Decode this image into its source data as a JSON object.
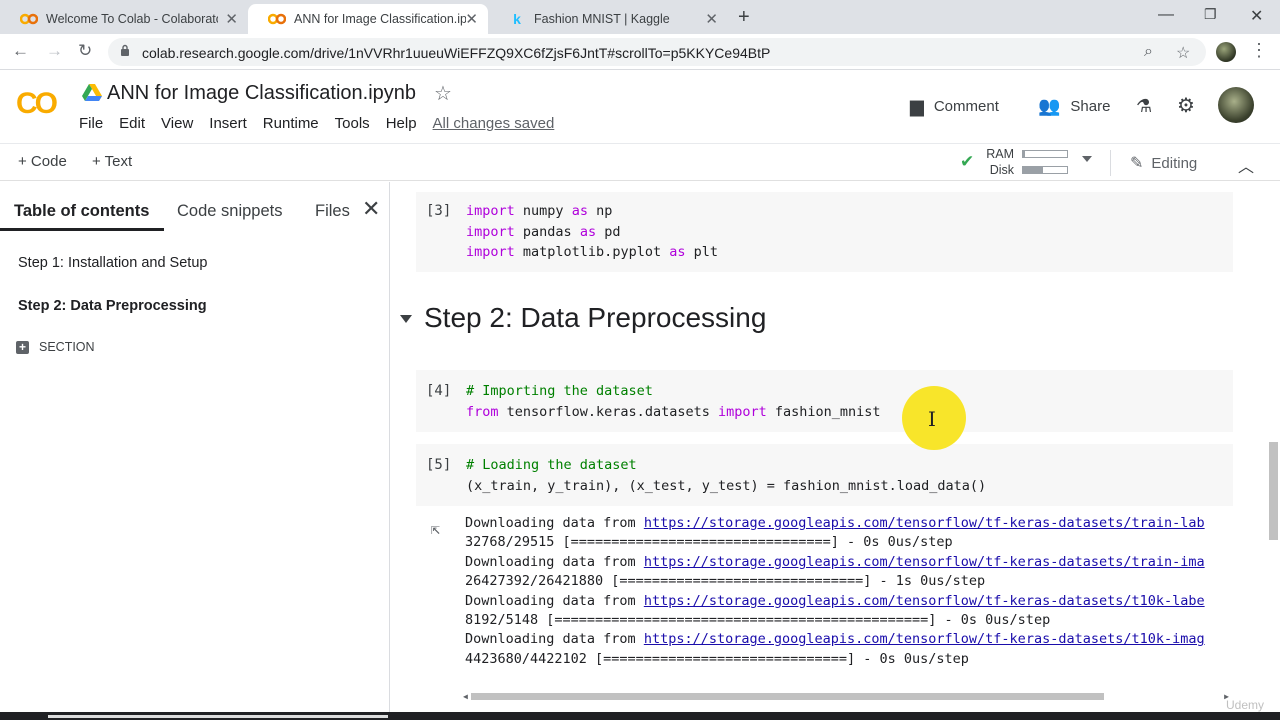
{
  "browser": {
    "tabs": [
      {
        "title": "Welcome To Colab - Colaboratory",
        "icon": "colab-icon"
      },
      {
        "title": "ANN for Image Classification.ipynb",
        "icon": "colab-icon"
      },
      {
        "title": "Fashion MNIST | Kaggle",
        "icon": "kaggle-icon"
      }
    ],
    "url": "colab.research.google.com/drive/1nVVRhr1uueuWiEFFZQ9XC6fZjsF6JntT#scrollTo=p5KKYCe94BtP"
  },
  "colab": {
    "logo": "CO",
    "notebook_title": "ANN for Image Classification.ipynb",
    "menu": [
      "File",
      "Edit",
      "View",
      "Insert",
      "Runtime",
      "Tools",
      "Help"
    ],
    "save_status": "All changes saved",
    "comment_label": "Comment",
    "share_label": "Share"
  },
  "toolbar": {
    "add_code": "+ Code",
    "add_text": "+ Text",
    "ram_label": "RAM",
    "disk_label": "Disk",
    "ram_usage": 0.05,
    "disk_usage": 0.45,
    "editing_label": "Editing"
  },
  "sidebar": {
    "tabs": [
      "Table of contents",
      "Code snippets",
      "Files"
    ],
    "toc": [
      "Step 1: Installation and Setup",
      "Step 2: Data Preprocessing"
    ],
    "section_label": "SECTION"
  },
  "notebook": {
    "cell3": {
      "exec": "[3]",
      "lines": [
        {
          "kw": "import",
          "rest1": " numpy ",
          "kw2": "as",
          "rest2": " np"
        },
        {
          "kw": "import",
          "rest1": " pandas ",
          "kw2": "as",
          "rest2": " pd"
        },
        {
          "kw": "import",
          "rest1": " matplotlib.pyplot ",
          "kw2": "as",
          "rest2": " plt"
        }
      ]
    },
    "heading": "Step 2: Data Preprocessing",
    "cell4": {
      "exec": "[4]",
      "comment": "# Importing the dataset",
      "from_kw": "from",
      "module": " tensorflow.keras.datasets ",
      "import_kw": "import",
      "name": " fashion_mnist"
    },
    "cell5": {
      "exec": "[5]",
      "comment": "# Loading the dataset",
      "code": "(x_train, y_train), (x_test, y_test) = fashion_mnist.load_data()"
    },
    "output": [
      {
        "prefix": "Downloading data from ",
        "link": "https://storage.googleapis.com/tensorflow/tf-keras-datasets/train-lab"
      },
      {
        "text": "32768/29515 [================================] - 0s 0us/step"
      },
      {
        "prefix": "Downloading data from ",
        "link": "https://storage.googleapis.com/tensorflow/tf-keras-datasets/train-ima"
      },
      {
        "text": "26427392/26421880 [==============================] - 1s 0us/step"
      },
      {
        "prefix": "Downloading data from ",
        "link": "https://storage.googleapis.com/tensorflow/tf-keras-datasets/t10k-labe"
      },
      {
        "text": "8192/5148 [==============================================] - 0s 0us/step"
      },
      {
        "prefix": "Downloading data from ",
        "link": "https://storage.googleapis.com/tensorflow/tf-keras-datasets/t10k-imag"
      },
      {
        "text": "4423680/4422102 [==============================] - 0s 0us/step"
      }
    ]
  },
  "watermark": "Udemy",
  "colors": {
    "accent": "#f9ab00",
    "keyword": "#af00db",
    "comment": "#008000",
    "link": "#1a0dab",
    "ok": "#34a853"
  }
}
